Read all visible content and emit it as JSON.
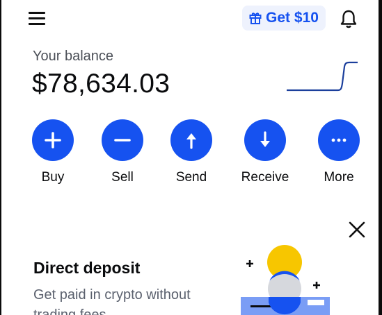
{
  "header": {
    "menu_icon": "hamburger-menu-icon",
    "promo_label": "Get $10",
    "promo_icon": "gift-icon",
    "bell_icon": "bell-icon"
  },
  "balance": {
    "label": "Your balance",
    "value": "$78,634.03"
  },
  "actions": [
    {
      "label": "Buy",
      "icon": "plus-icon"
    },
    {
      "label": "Sell",
      "icon": "minus-icon"
    },
    {
      "label": "Send",
      "icon": "arrow-up-icon"
    },
    {
      "label": "Receive",
      "icon": "arrow-down-icon"
    },
    {
      "label": "More",
      "icon": "ellipsis-icon"
    }
  ],
  "promo_card": {
    "title": "Direct deposit",
    "description": "Get paid in crypto without trading fees",
    "close_icon": "close-icon"
  },
  "colors": {
    "accent": "#1652f0",
    "accent_light": "#eef2fd",
    "text_primary": "#0a0b0d",
    "text_secondary": "#5b616e",
    "illustration_yellow": "#f7c600",
    "illustration_gray": "#d6d8dd"
  }
}
